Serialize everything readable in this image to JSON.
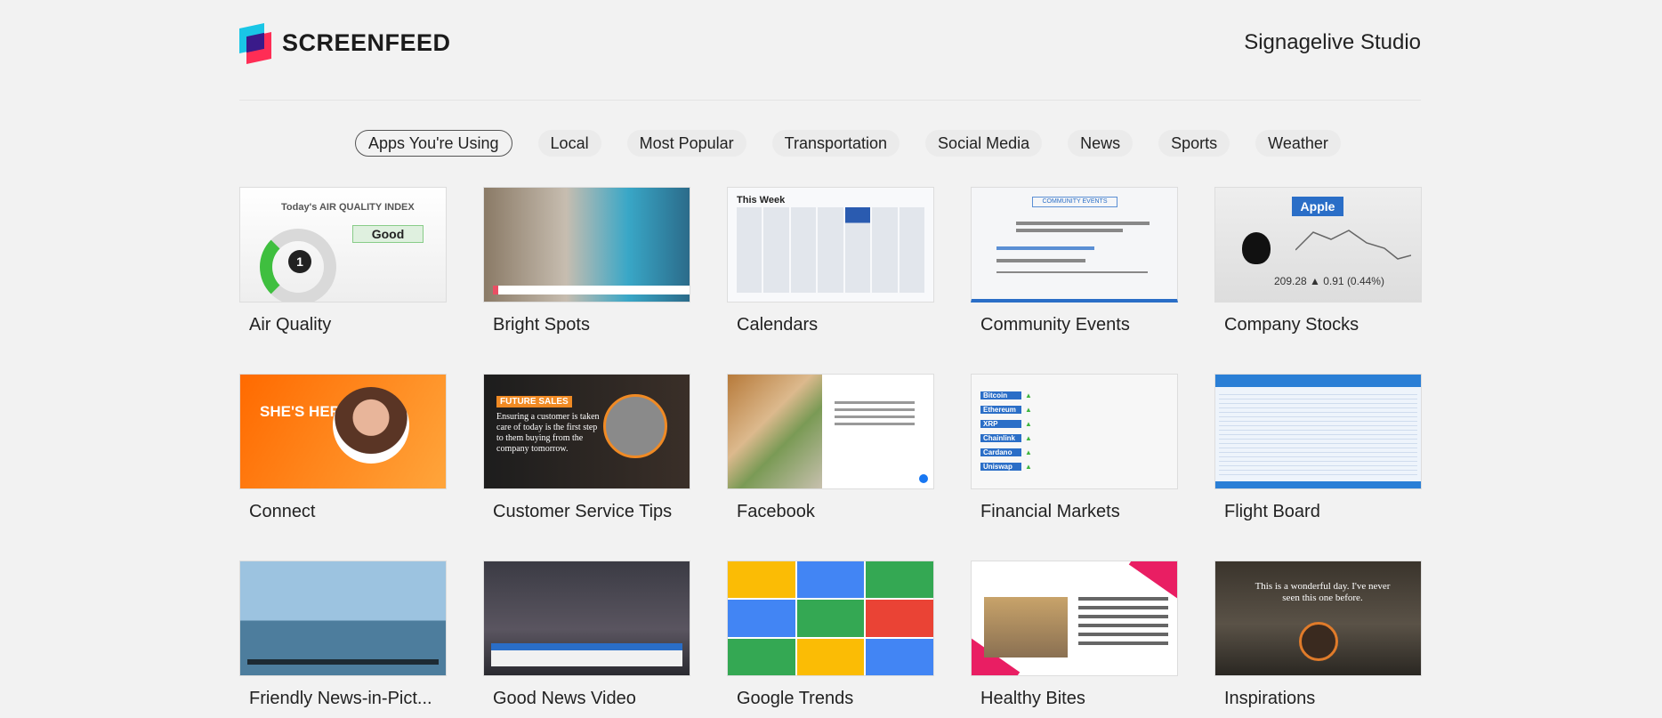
{
  "header": {
    "logo_text": "SCREENFEED",
    "studio_label": "Signagelive Studio"
  },
  "tabs": [
    {
      "label": "Apps You're Using",
      "active": true
    },
    {
      "label": "Local",
      "active": false
    },
    {
      "label": "Most Popular",
      "active": false
    },
    {
      "label": "Transportation",
      "active": false
    },
    {
      "label": "Social Media",
      "active": false
    },
    {
      "label": "News",
      "active": false
    },
    {
      "label": "Sports",
      "active": false
    },
    {
      "label": "Weather",
      "active": false
    }
  ],
  "apps": [
    {
      "label": "Air Quality",
      "thumb": {
        "title": "Today's AIR QUALITY INDEX",
        "value": "Good",
        "level": "1"
      }
    },
    {
      "label": "Bright Spots"
    },
    {
      "label": "Calendars",
      "thumb": {
        "title": "This Week"
      }
    },
    {
      "label": "Community Events",
      "thumb": {
        "badge": "COMMUNITY EVENTS"
      }
    },
    {
      "label": "Company Stocks",
      "thumb": {
        "ticker": "Apple",
        "price": "209.28 ▲ 0.91 (0.44%)"
      }
    },
    {
      "label": "Connect",
      "thumb": {
        "headline": "SHE'S HERE!"
      }
    },
    {
      "label": "Customer Service Tips",
      "thumb": {
        "tag": "FUTURE SALES",
        "text": "Ensuring a customer is taken care of today is the first step to them buying from the company tomorrow."
      }
    },
    {
      "label": "Facebook"
    },
    {
      "label": "Financial Markets",
      "thumb": {
        "rows": [
          "Bitcoin",
          "Ethereum",
          "XRP",
          "Chainlink",
          "Cardano",
          "Uniswap"
        ]
      }
    },
    {
      "label": "Flight Board"
    },
    {
      "label": "Friendly News-in-Pict..."
    },
    {
      "label": "Good News Video"
    },
    {
      "label": "Google Trends"
    },
    {
      "label": "Healthy Bites"
    },
    {
      "label": "Inspirations",
      "thumb": {
        "quote": "This is a wonderful day. I've never seen this one before."
      }
    }
  ]
}
